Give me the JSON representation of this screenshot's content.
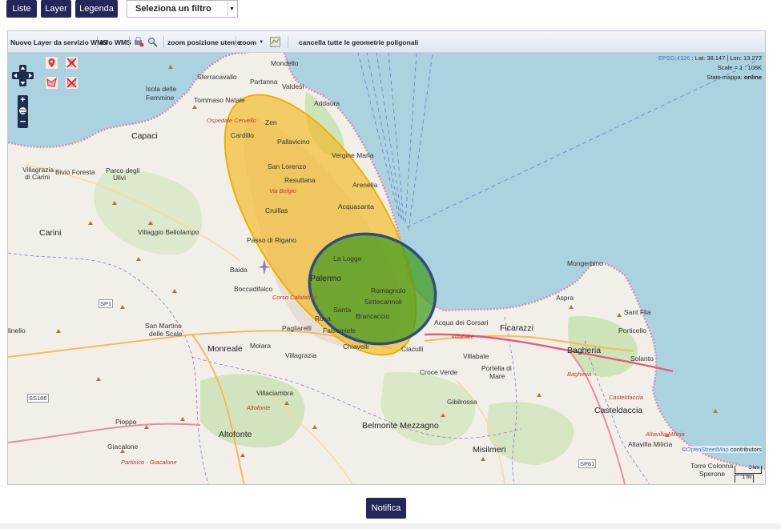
{
  "topbar": {
    "liste": "Liste",
    "layer": "Layer",
    "legenda": "Legenda",
    "filter_selected": "Seleziona un filtro"
  },
  "toolbar": {
    "new_wms": "Nuovo Layer da servizio WMS",
    "info_wms": "Info WMS",
    "zoom_user": "zoom posizione utente",
    "zoom": "zoom",
    "clear_polygons": "cancella tutte le geometrie poligonali"
  },
  "map_info": {
    "projection": "EPSG:4326",
    "coords": " : Lat: 38.147 | Lon: 13.277",
    "scale": "Scale = 1 : 108K",
    "state_label": "Stato mappa: ",
    "state_value": "online"
  },
  "attribution": {
    "symbol": "©",
    "link": "OpenStreetMap",
    "text": " contributors"
  },
  "scalebar": {
    "km": "2 km",
    "mi": "1 mi"
  },
  "places": {
    "mondello": "Mondello",
    "sferracavallo": "Sferracavallo",
    "partanna": "Partanna",
    "valdesi": "Valdesi",
    "isola": "Isola delle",
    "femmine": "Femmine",
    "tommaso": "Tommaso Natale",
    "addaura": "Addaura",
    "ospedale": "Ospedale Cervello",
    "zen": "Zen",
    "cardillo": "Cardillo",
    "pallavicino": "Pallavicino",
    "capaci": "Capaci",
    "vergine": "Vergine Maria",
    "villagrazia_carini_1": "Villagrazia",
    "villagrazia_carini_2": "di Carini",
    "bivio": "Bivio Foresta",
    "parco1": "Parco degli",
    "parco2": "Ulivi",
    "sanlorenzo": "San Lorenzo",
    "resuttana": "Resuttana",
    "arenella": "Arenella",
    "viabelgio": "Via Belgio",
    "acquasanta": "Acquasanta",
    "cruillas": "Cruillas",
    "carini": "Carini",
    "bellolampo": "Villaggio Bellolampo",
    "passo": "Passo di Rigano",
    "mongerbino": "Mongerbino",
    "lalogge": "La Logge",
    "baida": "Baida",
    "palermo": "Palermo",
    "boccadifalco": "Boccadifalco",
    "romagnolo": "Romagnolo",
    "settecannoli": "Settecannoli",
    "corsocalatafimi": "Corso Calatafimi",
    "aspra": "Aspra",
    "sp1": "SP1",
    "santaflavia": "Sant Flia",
    "santarosa1": "Santa",
    "santarosa2": "Rosa",
    "brancaccio": "Brancaccio",
    "acquacorsari": "Acqua dei Corsari",
    "ficarazzi": "Ficarazzi",
    "pagliarelli": "Pagliarelli",
    "falsomiele": "Falsomiele",
    "villabate_red": "Villabate",
    "porticello": "Porticello",
    "sanmartino1": "San Martino",
    "sanmartino2": "delle Scale",
    "bagheria": "Bagheria",
    "solanto": "Solanto",
    "monreale": "Monreale",
    "molara": "Molara",
    "chiavelli": "Chiavelli",
    "ciaculli": "Ciaculli",
    "villabate": "Villabate",
    "villagrazia": "Villagrazia",
    "portella1": "Portella di",
    "portella2": "Mare",
    "crocverde": "Croce Verde",
    "bagheria_red": "Bagheria",
    "ss186": "SS186",
    "villaciambra": "Villaciambra",
    "gibilrossa": "Gibilrossa",
    "casteldaccia_red": "Casteldaccia",
    "altofonte_red": "Altofonte",
    "casteldaccia": "Casteldaccia",
    "pioppo": "Pioppo",
    "belmonte": "Belmonte Mezzagno",
    "altofonte": "Altofonte",
    "giacalone": "Giacalone",
    "misilmeri": "Misilmeri",
    "altavilla_red": "Altavilla Milicia",
    "altavilla": "Altavilla Milicia",
    "partinico": "Partinico - Giacalone",
    "sp61": "SP61",
    "torre": "Torre Colonna",
    "sperone": "Sperone",
    "lnello": "linello",
    "villabate_road": "Villabate"
  },
  "notifica": "Notifica",
  "colors": {
    "accent": "#23275a",
    "sea": "#aad3df",
    "land": "#f2efe9"
  }
}
